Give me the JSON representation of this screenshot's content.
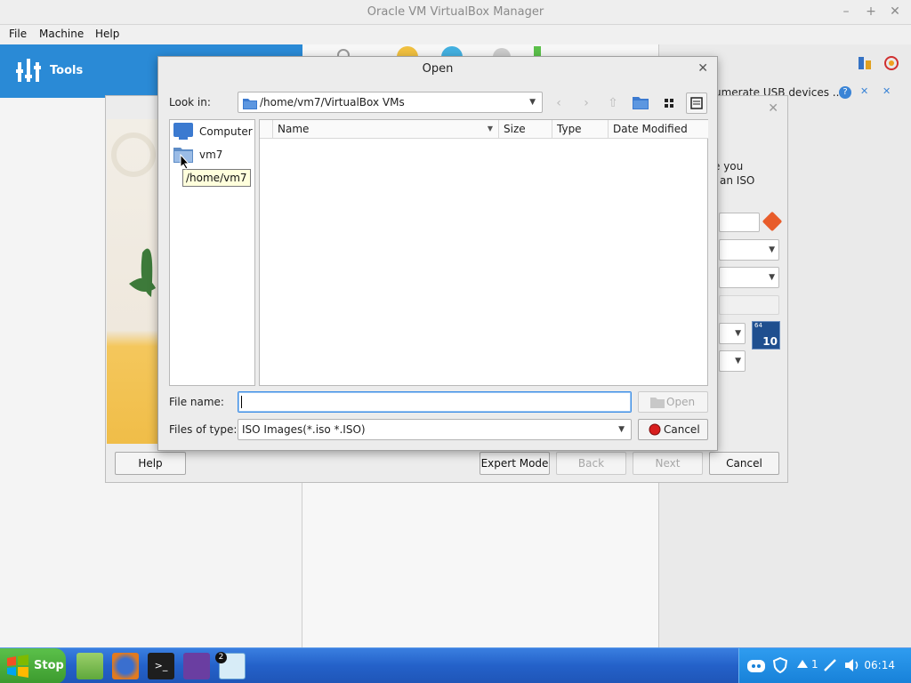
{
  "window": {
    "title": "Oracle VM VirtualBox Manager"
  },
  "menu": {
    "file": "File",
    "machine": "Machine",
    "help": "Help"
  },
  "tools": {
    "label": "Tools"
  },
  "right_pane": {
    "notification": "umerate USB devices ..."
  },
  "wizard": {
    "partial_text_1": "e you",
    "partial_text_2": "an ISO",
    "buttons": {
      "help": "Help",
      "expert": "Expert Mode",
      "back": "Back",
      "next": "Next",
      "cancel": "Cancel"
    },
    "os_badge": "10",
    "os_badge_small": "64"
  },
  "open_dialog": {
    "title": "Open",
    "look_in_label": "Look in:",
    "look_in_value": "/home/vm7/VirtualBox VMs",
    "places": [
      {
        "label": "Computer",
        "icon": "computer-icon"
      },
      {
        "label": "vm7",
        "icon": "folder-icon"
      }
    ],
    "tooltip": "/home/vm7",
    "columns": [
      "Name",
      "Size",
      "Type",
      "Date Modified"
    ],
    "file_name_label": "File name:",
    "file_name_value": "",
    "files_of_type_label": "Files of type:",
    "files_of_type_value": "ISO Images(*.iso *.ISO)",
    "open_button": "Open",
    "cancel_button": "Cancel"
  },
  "taskbar": {
    "start_label": "Stop",
    "badge": "2",
    "tray_number": "1",
    "time": "06:14"
  },
  "colors": {
    "tools_blue": "#2a8ad6",
    "taskbar_blue": "#2461c9",
    "start_green": "#3c9a2e",
    "input_focus": "#3d8ee6"
  }
}
